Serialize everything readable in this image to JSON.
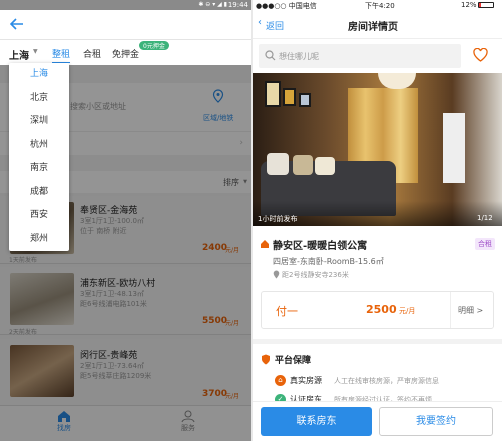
{
  "left": {
    "status_bar": {
      "time": "19:44"
    },
    "header": {
      "city": "上海",
      "tabs": [
        "整租",
        "合租",
        "免押金"
      ],
      "badge": "0元押金"
    },
    "dropdown": {
      "options": [
        "上海",
        "北京",
        "深圳",
        "杭州",
        "南京",
        "成都",
        "西安",
        "郑州"
      ],
      "selected": "上海"
    },
    "search": {
      "placeholder": "搜索小区或地址"
    },
    "map_button": "区域/地铁",
    "sort_label": "排序",
    "listings": [
      {
        "title": "奉贤区-金海苑",
        "detail": "3室1厅1卫-100.0㎡",
        "location": "位于 南桥 附近",
        "price": "2400",
        "unit": "元/月",
        "posted": "1天前发布"
      },
      {
        "title": "浦东新区-欧坊八村",
        "detail": "3室1厅1卫-48.13㎡",
        "location": "距6号线浦电路101米",
        "price": "5500",
        "unit": "元/月",
        "posted": "2天前发布"
      },
      {
        "title": "闵行区-贵峰苑",
        "detail": "2室1厅1卫-73.64㎡",
        "location": "距5号线莘庄路1209米",
        "price": "3700",
        "unit": "元/月",
        "posted": ""
      }
    ],
    "bottom_nav": [
      {
        "label": "找房",
        "icon": "home-icon",
        "active": true
      },
      {
        "label": "服务",
        "icon": "user-icon",
        "active": false
      }
    ]
  },
  "right": {
    "status_bar": {
      "carrier": "●●●○○ 中国电信",
      "time": "下午4:20",
      "battery": "12%"
    },
    "nav": {
      "back": "返回",
      "title": "房间详情页"
    },
    "search": {
      "placeholder": "想住哪儿呢"
    },
    "photo": {
      "caption": "1小时前发布",
      "counter": "1/12"
    },
    "listing": {
      "title": "静安区-暖暖白领公寓",
      "tag": "合租",
      "detail": "四居室-东南卧-RoomB-15.6㎡",
      "location": "距2号线静安寺236米"
    },
    "payment": {
      "plan": "付一",
      "price": "2500",
      "unit": "元/月",
      "link": "明细 >"
    },
    "guarantee": {
      "title": "平台保障",
      "items": [
        {
          "label": "真实房源",
          "desc": "人工在线审核房源，严审房源信息"
        },
        {
          "label": "认证房东",
          "desc": "所有房源经过认证，签约不再烦"
        }
      ]
    },
    "actions": {
      "contact": "联系房东",
      "sign": "我要签约"
    },
    "accent": "#2a8be6",
    "price_color": "#e8630a"
  }
}
